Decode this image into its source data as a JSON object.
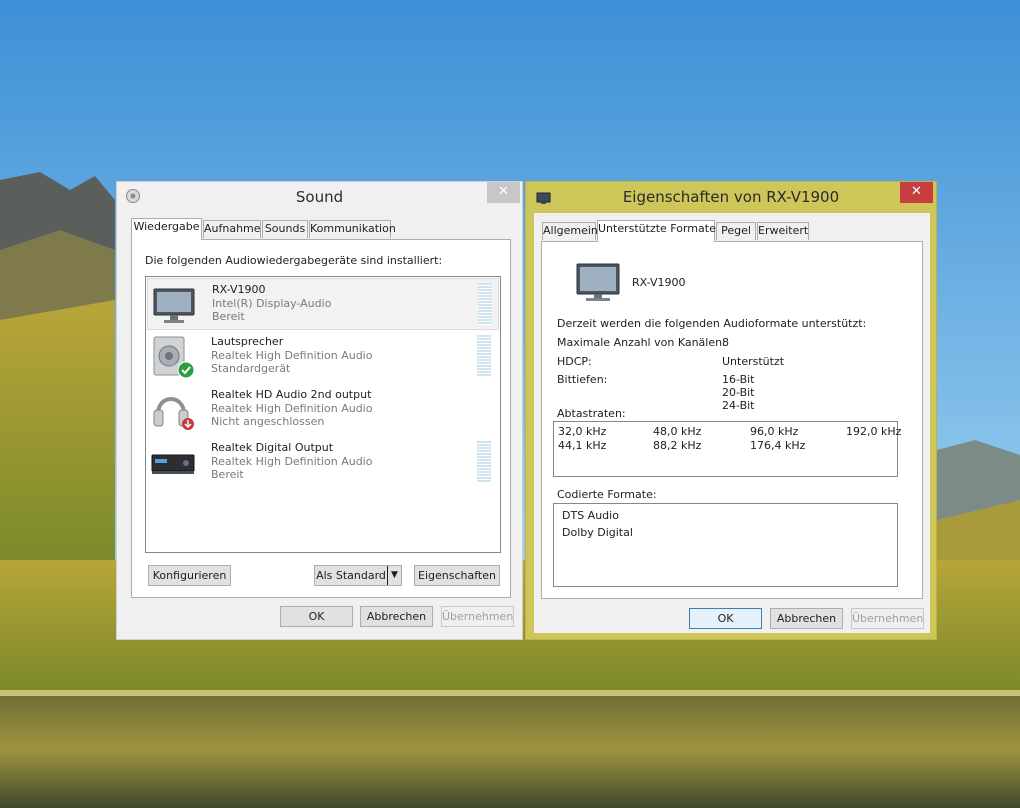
{
  "colors": {
    "sky_top": "#3d8fd6",
    "sky_bottom": "#cde7f7",
    "props_frame": "#cfc65a",
    "close_active": "#c83e3e",
    "accent_blue": "#3c7fb1"
  },
  "sound_window": {
    "title": "Sound",
    "icon": "speaker-icon",
    "close_label": "✕",
    "tabs": [
      {
        "label": "Wiedergabe",
        "active": true
      },
      {
        "label": "Aufnahme",
        "active": false
      },
      {
        "label": "Sounds",
        "active": false
      },
      {
        "label": "Kommunikation",
        "active": false
      }
    ],
    "heading": "Die folgenden Audiowiedergabegeräte sind installiert:",
    "devices": [
      {
        "name": "RX-V1900",
        "driver": "Intel(R) Display-Audio",
        "status": "Bereit",
        "icon": "monitor-icon",
        "selected": true
      },
      {
        "name": "Lautsprecher",
        "driver": "Realtek High Definition Audio",
        "status": "Standardgerät",
        "icon": "speaker-default-icon",
        "selected": false
      },
      {
        "name": "Realtek HD Audio 2nd output",
        "driver": "Realtek High Definition Audio",
        "status": "Nicht angeschlossen",
        "icon": "headphones-icon",
        "selected": false
      },
      {
        "name": "Realtek Digital Output",
        "driver": "Realtek High Definition Audio",
        "status": "Bereit",
        "icon": "digital-output-icon",
        "selected": false
      }
    ],
    "buttons": {
      "configure": "Konfigurieren",
      "set_default": "Als Standard",
      "properties": "Eigenschaften",
      "ok": "OK",
      "cancel": "Abbrechen",
      "apply": "Übernehmen"
    }
  },
  "props_window": {
    "title": "Eigenschaften von RX-V1900",
    "icon": "monitor-small-icon",
    "close_label": "✕",
    "tabs": [
      {
        "label": "Allgemein",
        "active": false
      },
      {
        "label": "Unterstützte Formate",
        "active": true
      },
      {
        "label": "Pegel",
        "active": false
      },
      {
        "label": "Erweitert",
        "active": false
      }
    ],
    "device_name": "RX-V1900",
    "formats_heading": "Derzeit werden die folgenden Audioformate unterstützt:",
    "max_channels_label": "Maximale Anzahl von Kanälen:",
    "max_channels_value": "8",
    "hdcp_label": "HDCP:",
    "hdcp_value": "Unterstützt",
    "bit_depth_label": "Bittiefen:",
    "bit_depths": [
      "16-Bit",
      "20-Bit",
      "24-Bit"
    ],
    "sample_rates_label": "Abtastraten:",
    "sample_rates": [
      [
        "32,0 kHz",
        "48,0 kHz",
        "96,0 kHz",
        "192,0 kHz"
      ],
      [
        "44,1 kHz",
        "88,2 kHz",
        "176,4 kHz",
        ""
      ]
    ],
    "encoded_label": "Codierte Formate:",
    "encoded_formats": [
      "DTS Audio",
      "Dolby Digital"
    ],
    "buttons": {
      "ok": "OK",
      "cancel": "Abbrechen",
      "apply": "Übernehmen"
    }
  }
}
